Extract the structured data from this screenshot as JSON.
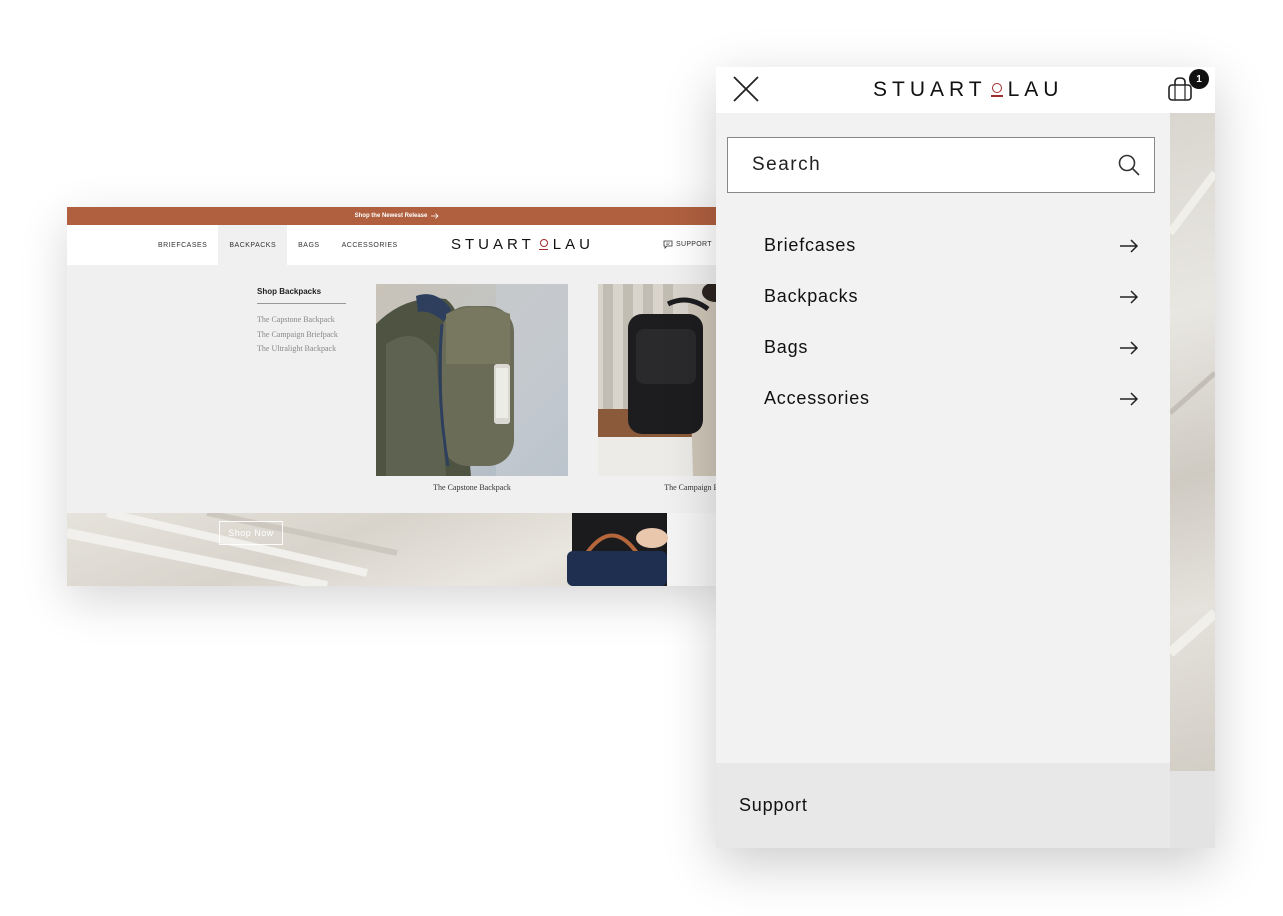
{
  "desktop": {
    "promo_text": "Shop the Newest Release",
    "nav": {
      "items": [
        {
          "label": "BRIEFCASES"
        },
        {
          "label": "BACKPACKS",
          "active": true
        },
        {
          "label": "BAGS"
        },
        {
          "label": "ACCESSORIES"
        }
      ]
    },
    "logo": {
      "left": "STUART",
      "right": "LAU"
    },
    "support_label": "SUPPORT",
    "mega_menu": {
      "title": "Shop Backpacks",
      "links": [
        "The Capstone Backpack",
        "The Campaign Briefpack",
        "The Ultralight Backpack"
      ],
      "products": [
        {
          "name": "The Capstone Backpack"
        },
        {
          "name": "The Campaign Bri"
        }
      ]
    },
    "hero": {
      "button_label": "Shop Now"
    }
  },
  "mobile": {
    "logo": {
      "left": "STUART",
      "right": "LAU"
    },
    "cart_count": "1",
    "search": {
      "placeholder": "Search"
    },
    "menu": [
      {
        "label": "Briefcases"
      },
      {
        "label": "Backpacks"
      },
      {
        "label": "Bags"
      },
      {
        "label": "Accessories"
      }
    ],
    "support_label": "Support"
  },
  "colors": {
    "promo_bar": "#b0603f",
    "logo_accent": "#a22b2b",
    "panel_bg": "#f2f2f2"
  },
  "icons": {
    "close": "close-icon",
    "cart": "shopping-bag-icon",
    "search": "search-icon",
    "menu_arrow": "arrow-right-icon",
    "support": "chat-bubble-icon"
  }
}
